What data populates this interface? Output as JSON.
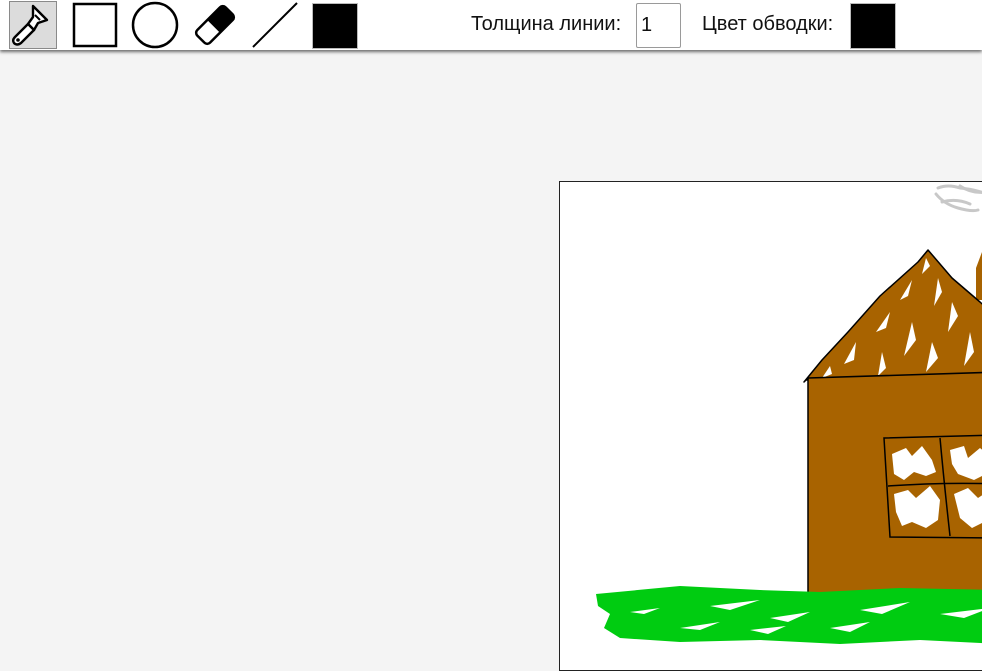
{
  "toolbar": {
    "tools": [
      {
        "name": "brush",
        "icon": "brush-icon",
        "active": true
      },
      {
        "name": "rectangle",
        "icon": "rectangle-icon",
        "active": false
      },
      {
        "name": "ellipse",
        "icon": "ellipse-icon",
        "active": false
      },
      {
        "name": "eraser",
        "icon": "eraser-icon",
        "active": false
      },
      {
        "name": "line",
        "icon": "line-icon",
        "active": false
      }
    ],
    "fill_color": "#000000",
    "line_width_label": "Толщина линии:",
    "line_width_value": "1",
    "stroke_color_label": "Цвет обводки:",
    "stroke_color": "#000000"
  },
  "colors": {
    "workspace": "#f4f4f4",
    "canvas": "#ffffff",
    "roof": "#a86300",
    "wall": "#a86300",
    "grass": "#00cc11",
    "smoke": "#c8c8c8",
    "window_glass": "#ffffff",
    "outline": "#000000"
  }
}
